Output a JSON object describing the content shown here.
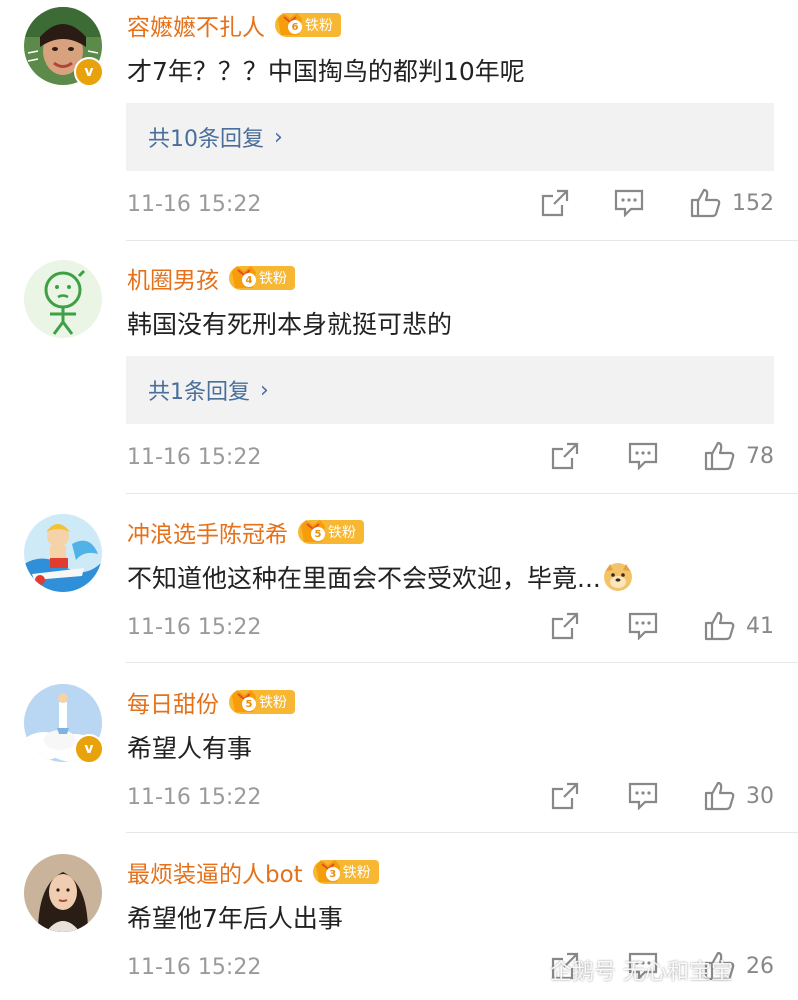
{
  "colors": {
    "username": "#e5711a",
    "reply_link": "#4a6e9b",
    "meta": "#9a9a9a",
    "badge": "#f7b733"
  },
  "comments": [
    {
      "username": "容嬷嬷不扎人",
      "fan_label": "铁粉",
      "fan_level": "6",
      "verified": true,
      "verified_badge": "v",
      "text": "才7年？？？中国掏鸟的都判10年呢",
      "reply_label": "共10条回复",
      "reply_chevron": "›",
      "time": "11-16 15:22",
      "likes": "152",
      "avatar_icon": "woman-avatar-icon"
    },
    {
      "username": "机圈男孩",
      "fan_label": "铁粉",
      "fan_level": "4",
      "verified": false,
      "text": "韩国没有死刑本身就挺可悲的",
      "reply_label": "共1条回复",
      "reply_chevron": "›",
      "time": "11-16 15:22",
      "likes": "78",
      "avatar_icon": "green-doodle-avatar-icon"
    },
    {
      "username": "冲浪选手陈冠希",
      "fan_label": "铁粉",
      "fan_level": "5",
      "verified": false,
      "text": "不知道他这种在里面会不会受欢迎，毕竟...",
      "emoji_icon": "doge-emoji-icon",
      "time": "11-16 15:22",
      "likes": "41",
      "avatar_icon": "surfer-cartoon-avatar-icon"
    },
    {
      "username": "每日甜份",
      "fan_label": "铁粉",
      "fan_level": "5",
      "verified": true,
      "verified_badge": "v",
      "text": "希望人有事",
      "time": "11-16 15:22",
      "likes": "30",
      "avatar_icon": "cloud-figure-avatar-icon"
    },
    {
      "username": "最烦装逼的人bot",
      "fan_label": "铁粉",
      "fan_level": "3",
      "verified": false,
      "text": "希望他7年后人出事",
      "time": "11-16 15:22",
      "likes": "26",
      "avatar_icon": "woman-portrait-avatar-icon"
    }
  ],
  "watermark": "企鹅号 无心和宝宝"
}
